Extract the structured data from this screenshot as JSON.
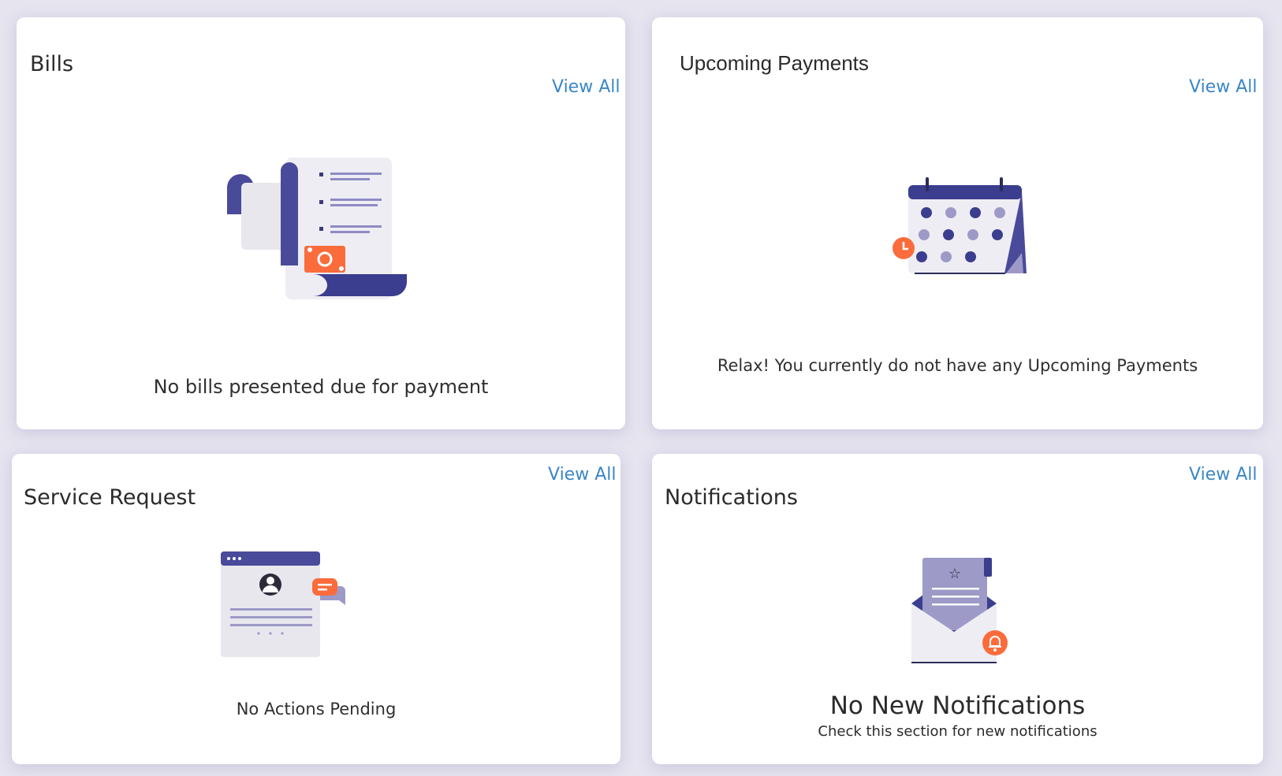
{
  "colors": {
    "background": "#e6e4ef",
    "card": "#ffffff",
    "link": "#3a86c8",
    "illustration_primary": "#4a4a9a",
    "illustration_light": "#eeedf3",
    "illustration_accent": "#fa6c3c",
    "illustration_muted": "#9d9ac8"
  },
  "bills": {
    "title": "Bills",
    "view_all": "View All",
    "icon": "bill-receipt-icon",
    "empty_message": "No bills presented due for payment"
  },
  "upcoming_payments": {
    "title": "Upcoming Payments",
    "view_all": "View All",
    "icon": "calendar-clock-icon",
    "empty_message": "Relax! You currently do not have any Upcoming Payments"
  },
  "service_request": {
    "title": "Service Request",
    "view_all": "View All",
    "icon": "profile-chat-icon",
    "empty_message": "No Actions Pending"
  },
  "notifications": {
    "title": "Notifications",
    "view_all": "View All",
    "icon": "envelope-bell-icon",
    "empty_title": "No New Notifications",
    "empty_subtitle": "Check this section for new notifications"
  }
}
